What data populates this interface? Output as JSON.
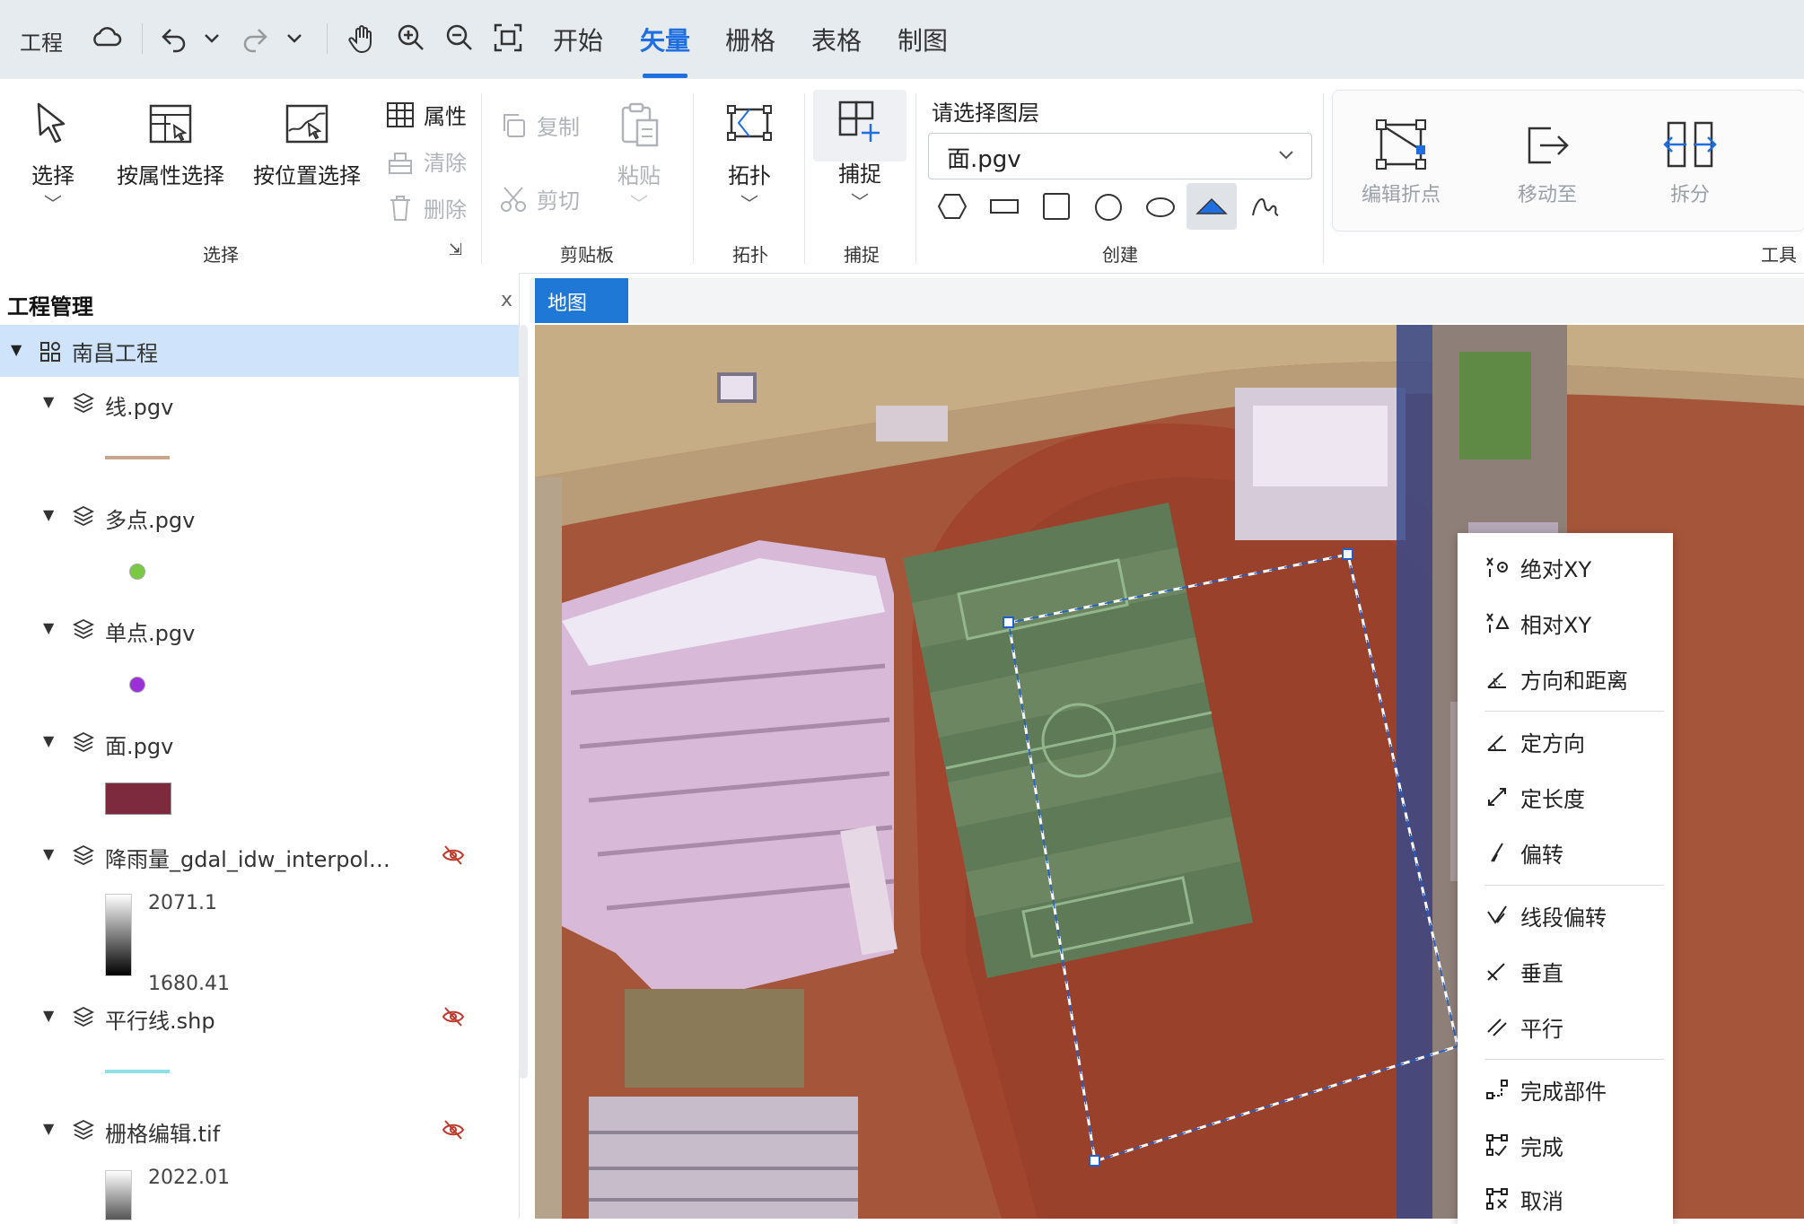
{
  "topbar": {
    "project_label": "工程",
    "tabs": [
      {
        "label": "开始",
        "active": false
      },
      {
        "label": "矢量",
        "active": true
      },
      {
        "label": "栅格",
        "active": false
      },
      {
        "label": "表格",
        "active": false
      },
      {
        "label": "制图",
        "active": false
      }
    ],
    "accent_color": "#1f6fe0"
  },
  "ribbon": {
    "select_group": {
      "label": "选择",
      "select_btn": "选择",
      "by_attr_btn": "按属性选择",
      "by_location_btn": "按位置选择",
      "attributes_btn": "属性",
      "clear_btn": "清除",
      "delete_btn": "删除"
    },
    "clipboard_group": {
      "label": "剪贴板",
      "copy_btn": "复制",
      "cut_btn": "剪切",
      "paste_btn": "粘贴"
    },
    "topology_group": {
      "label": "拓扑",
      "topology_btn": "拓扑"
    },
    "snap_group": {
      "label": "捕捉",
      "snap_btn": "捕捉"
    },
    "create_group": {
      "label": "创建",
      "layer_prompt": "请选择图层",
      "selected_layer": "面.pgv",
      "shapes": [
        "hexagon-icon",
        "rectangle-icon",
        "square-icon",
        "circle-icon",
        "ellipse-icon",
        "triangle-icon",
        "freehand-icon"
      ]
    },
    "tools_group": {
      "label": "工具",
      "edit_vertices_btn": "编辑折点",
      "move_to_btn": "移动至",
      "split_btn": "拆分"
    }
  },
  "project_panel": {
    "title": "工程管理",
    "close": "x",
    "project_name": "南昌工程",
    "layers": [
      {
        "name": "线.pgv",
        "legend": "line",
        "color": "#c9a58a",
        "visible": true
      },
      {
        "name": "多点.pgv",
        "legend": "point",
        "color": "#7ac943",
        "visible": true
      },
      {
        "name": "单点.pgv",
        "legend": "point",
        "color": "#9b30d9",
        "visible": true
      },
      {
        "name": "面.pgv",
        "legend": "polygon",
        "color": "#7d2a3e",
        "visible": true
      },
      {
        "name": "降雨量_gdal_idw_interpol…",
        "legend": "ramp",
        "max": "2071.1",
        "min": "1680.41",
        "visible": false
      },
      {
        "name": "平行线.shp",
        "legend": "line",
        "color": "#8ee0e6",
        "visible": false
      },
      {
        "name": "栅格编辑.tif",
        "legend": "ramp",
        "max": "2022.01",
        "visible": false
      }
    ]
  },
  "map": {
    "tab_label": "地图"
  },
  "context_menu": {
    "items": [
      {
        "label": "绝对XY",
        "icon": "absolute-xy-icon"
      },
      {
        "label": "相对XY",
        "icon": "relative-xy-icon"
      },
      {
        "label": "方向和距离",
        "icon": "direction-distance-icon"
      },
      {
        "label": "定方向",
        "icon": "fixed-direction-icon"
      },
      {
        "label": "定长度",
        "icon": "fixed-length-icon"
      },
      {
        "label": "偏转",
        "icon": "deflection-icon"
      },
      {
        "label": "线段偏转",
        "icon": "segment-deflection-icon"
      },
      {
        "label": "垂直",
        "icon": "perpendicular-icon"
      },
      {
        "label": "平行",
        "icon": "parallel-icon"
      },
      {
        "label": "完成部件",
        "icon": "finish-part-icon"
      },
      {
        "label": "完成",
        "icon": "finish-icon"
      },
      {
        "label": "取消",
        "icon": "cancel-icon"
      }
    ]
  }
}
